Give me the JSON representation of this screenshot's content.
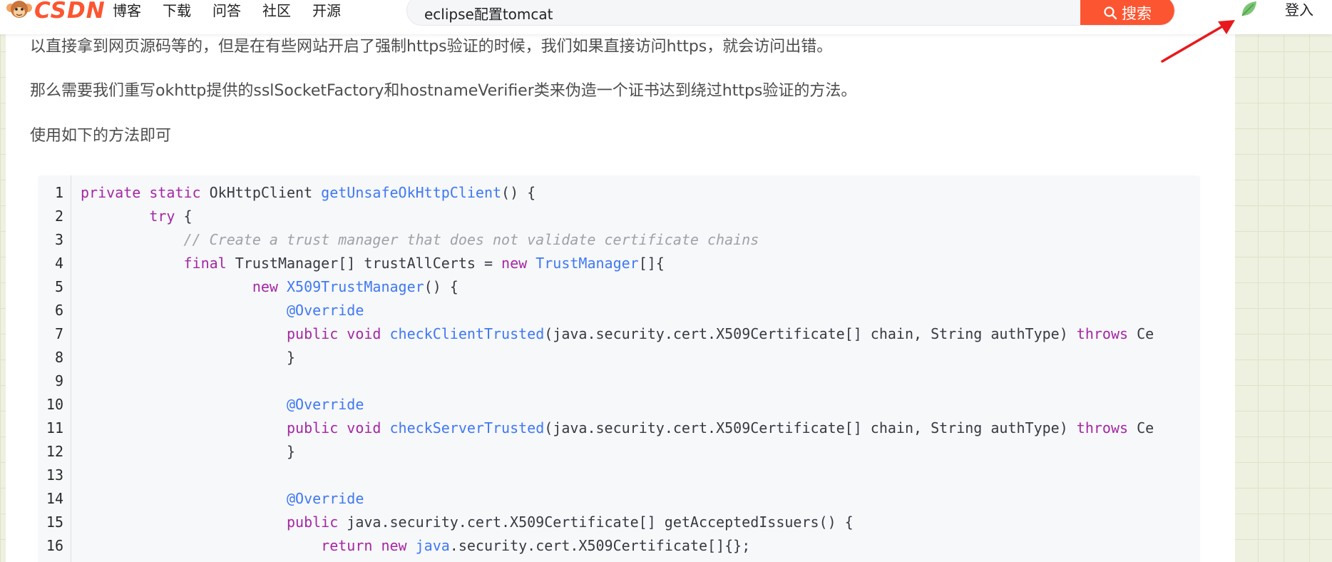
{
  "header": {
    "logo_text": "CSDN",
    "nav_items": [
      "博客",
      "下载",
      "问答",
      "社区",
      "开源"
    ],
    "search_value": "eclipse配置tomcat",
    "search_button_label": "搜索",
    "login_label": "登入"
  },
  "article": {
    "paragraphs": [
      "以直接拿到网页源码等的，但是在有些网站开启了强制https验证的时候，我们如果直接访问https，就会访问出错。",
      "那么需要我们重写okhttp提供的sslSocketFactory和hostnameVerifier类来伪造一个证书达到绕过https验证的方法。",
      "使用如下的方法即可"
    ],
    "code": {
      "line_numbers": [
        "1",
        "2",
        "3",
        "4",
        "5",
        "6",
        "7",
        "8",
        "9",
        "10",
        "11",
        "12",
        "13",
        "14",
        "15",
        "16"
      ],
      "lines": [
        [
          {
            "t": "kw",
            "v": "private"
          },
          {
            "t": "tx",
            "v": " "
          },
          {
            "t": "kw",
            "v": "static"
          },
          {
            "t": "tx",
            "v": " OkHttpClient "
          },
          {
            "t": "fn",
            "v": "getUnsafeOkHttpClient"
          },
          {
            "t": "tx",
            "v": "() {"
          }
        ],
        [
          {
            "t": "tx",
            "v": "        "
          },
          {
            "t": "kw",
            "v": "try"
          },
          {
            "t": "tx",
            "v": " {"
          }
        ],
        [
          {
            "t": "tx",
            "v": "            "
          },
          {
            "t": "cm",
            "v": "// Create a trust manager that does not validate certificate chains"
          }
        ],
        [
          {
            "t": "tx",
            "v": "            "
          },
          {
            "t": "kw",
            "v": "final"
          },
          {
            "t": "tx",
            "v": " TrustManager[] trustAllCerts = "
          },
          {
            "t": "kw",
            "v": "new"
          },
          {
            "t": "tx",
            "v": " "
          },
          {
            "t": "fn",
            "v": "TrustManager"
          },
          {
            "t": "tx",
            "v": "[]{"
          }
        ],
        [
          {
            "t": "tx",
            "v": "                    "
          },
          {
            "t": "kw",
            "v": "new"
          },
          {
            "t": "tx",
            "v": " "
          },
          {
            "t": "fn",
            "v": "X509TrustManager"
          },
          {
            "t": "tx",
            "v": "() {"
          }
        ],
        [
          {
            "t": "tx",
            "v": "                        "
          },
          {
            "t": "an",
            "v": "@Override"
          }
        ],
        [
          {
            "t": "tx",
            "v": "                        "
          },
          {
            "t": "kw",
            "v": "public"
          },
          {
            "t": "tx",
            "v": " "
          },
          {
            "t": "kw",
            "v": "void"
          },
          {
            "t": "tx",
            "v": " "
          },
          {
            "t": "fn",
            "v": "checkClientTrusted"
          },
          {
            "t": "tx",
            "v": "(java.security.cert.X509Certificate[] chain, String authType) "
          },
          {
            "t": "kw",
            "v": "throws"
          },
          {
            "t": "tx",
            "v": " Ce"
          }
        ],
        [
          {
            "t": "tx",
            "v": "                        }"
          }
        ],
        [
          {
            "t": "tx",
            "v": ""
          }
        ],
        [
          {
            "t": "tx",
            "v": "                        "
          },
          {
            "t": "an",
            "v": "@Override"
          }
        ],
        [
          {
            "t": "tx",
            "v": "                        "
          },
          {
            "t": "kw",
            "v": "public"
          },
          {
            "t": "tx",
            "v": " "
          },
          {
            "t": "kw",
            "v": "void"
          },
          {
            "t": "tx",
            "v": " "
          },
          {
            "t": "fn",
            "v": "checkServerTrusted"
          },
          {
            "t": "tx",
            "v": "(java.security.cert.X509Certificate[] chain, String authType) "
          },
          {
            "t": "kw",
            "v": "throws"
          },
          {
            "t": "tx",
            "v": " Ce"
          }
        ],
        [
          {
            "t": "tx",
            "v": "                        }"
          }
        ],
        [
          {
            "t": "tx",
            "v": ""
          }
        ],
        [
          {
            "t": "tx",
            "v": "                        "
          },
          {
            "t": "an",
            "v": "@Override"
          }
        ],
        [
          {
            "t": "tx",
            "v": "                        "
          },
          {
            "t": "kw",
            "v": "public"
          },
          {
            "t": "tx",
            "v": " java.security.cert.X509Certificate[] getAcceptedIssuers() {"
          }
        ],
        [
          {
            "t": "tx",
            "v": "                            "
          },
          {
            "t": "kw",
            "v": "return"
          },
          {
            "t": "tx",
            "v": " "
          },
          {
            "t": "kw",
            "v": "new"
          },
          {
            "t": "tx",
            "v": " "
          },
          {
            "t": "fn",
            "v": "java"
          },
          {
            "t": "tx",
            "v": ".security.cert.X509Certificate[]{};"
          }
        ]
      ]
    }
  },
  "colors": {
    "brand": "#fc5531",
    "keyword": "#a626a4",
    "function": "#4078f2",
    "comment": "#a0a1a7",
    "annotation_arrow": "#e8191c"
  },
  "icons": {
    "search": "search-icon",
    "leaf": "leaf-icon",
    "mascot": "mascot-icon"
  }
}
